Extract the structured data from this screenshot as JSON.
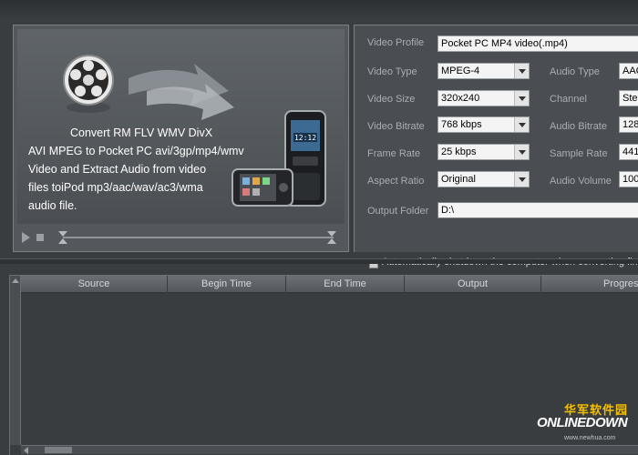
{
  "preview": {
    "promo_line1": "Convert RM FLV WMV DivX",
    "promo_line2": "AVI MPEG to Pocket PC avi/3gp/mp4/wmv",
    "promo_line3": "Video and Extract Audio from video",
    "promo_line4": "files toiPod mp3/aac/wav/ac3/wma",
    "promo_line5": "audio file.",
    "phone_clock": "12:12"
  },
  "settings": {
    "video_profile": {
      "label": "Video Profile",
      "value": "Pocket PC MP4 video(.mp4)"
    },
    "video_type": {
      "label": "Video Type",
      "value": "MPEG-4"
    },
    "video_size": {
      "label": "Video Size",
      "value": "320x240"
    },
    "video_bitrate": {
      "label": "Video Bitrate",
      "value": "768 kbps"
    },
    "frame_rate": {
      "label": "Frame Rate",
      "value": "25 kbps"
    },
    "aspect_ratio": {
      "label": "Aspect Ratio",
      "value": "Original"
    },
    "audio_type": {
      "label": "Audio Type",
      "value": "AAC"
    },
    "channel": {
      "label": "Channel",
      "value": "Stereo"
    },
    "audio_bitrate": {
      "label": "Audio Bitrate",
      "value": "128"
    },
    "sample_rate": {
      "label": "Sample Rate",
      "value": "441"
    },
    "audio_volume": {
      "label": "Audio Volume",
      "value": "100"
    },
    "output_folder": {
      "label": "Output Folder",
      "value": "D:\\"
    },
    "shutdown": {
      "label": "Automatically shutdown the computer when converting finis",
      "checked": false
    }
  },
  "file_list": {
    "columns": [
      "Source",
      "Begin Time",
      "End Time",
      "Output",
      "Progress"
    ]
  },
  "watermark": {
    "cn": "华军软件园",
    "en": "ONLINEDOWN",
    "url": "www.newhua.com"
  },
  "colors": {
    "background": "#3a3d40",
    "panel": "#4a4e52",
    "watermark_gold": "#f6c000"
  }
}
